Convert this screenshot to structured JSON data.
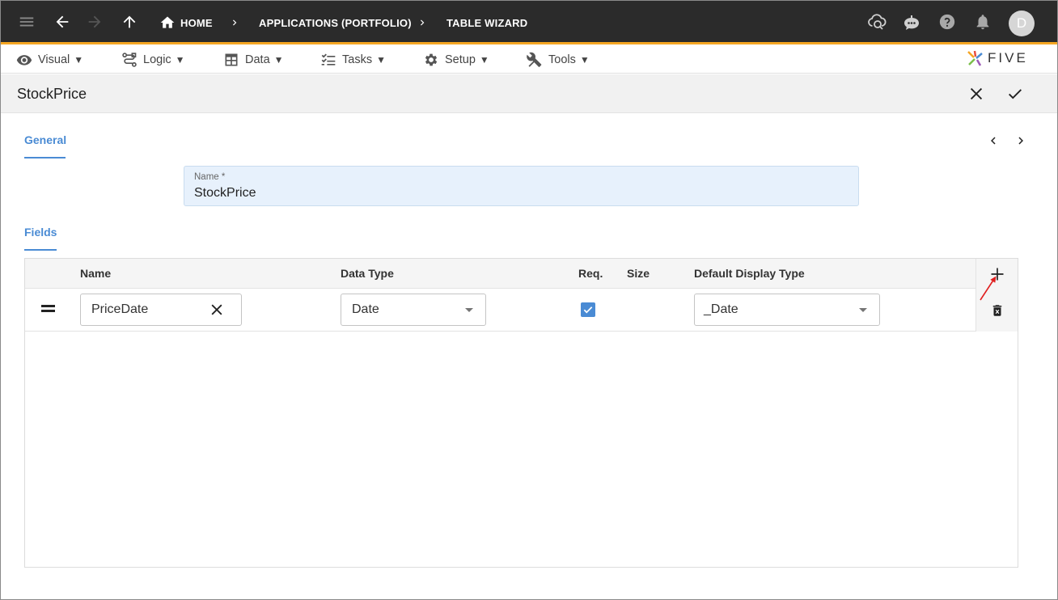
{
  "appbar": {
    "breadcrumbs": [
      "HOME",
      "APPLICATIONS (PORTFOLIO)",
      "TABLE WIZARD"
    ],
    "avatar_initial": "D",
    "icons": [
      "menu-icon",
      "back-arrow-icon",
      "forward-arrow-icon",
      "up-arrow-icon",
      "home-icon",
      "cloud-sync-icon",
      "chatbot-icon",
      "help-icon",
      "bell-icon"
    ],
    "accent_color": "#f5a623"
  },
  "menubar": {
    "items": [
      {
        "label": "Visual",
        "icon": "eye-icon"
      },
      {
        "label": "Logic",
        "icon": "logic-icon"
      },
      {
        "label": "Data",
        "icon": "table-icon"
      },
      {
        "label": "Tasks",
        "icon": "checklist-icon"
      },
      {
        "label": "Setup",
        "icon": "gear-icon"
      },
      {
        "label": "Tools",
        "icon": "tools-icon"
      }
    ],
    "caret": "▼",
    "logo_text": "FIVE"
  },
  "form": {
    "title": "StockPrice",
    "general_tab": "General",
    "fields_tab": "Fields",
    "name_label": "Name *",
    "name_value": "StockPrice",
    "tab_color": "#4a8bd4"
  },
  "grid": {
    "columns": [
      "Name",
      "Data Type",
      "Req.",
      "Size",
      "Default Display Type"
    ],
    "rows": [
      {
        "name": "PriceDate",
        "data_type": "Date",
        "required": true,
        "size": "",
        "display_type": "_Date"
      }
    ]
  }
}
